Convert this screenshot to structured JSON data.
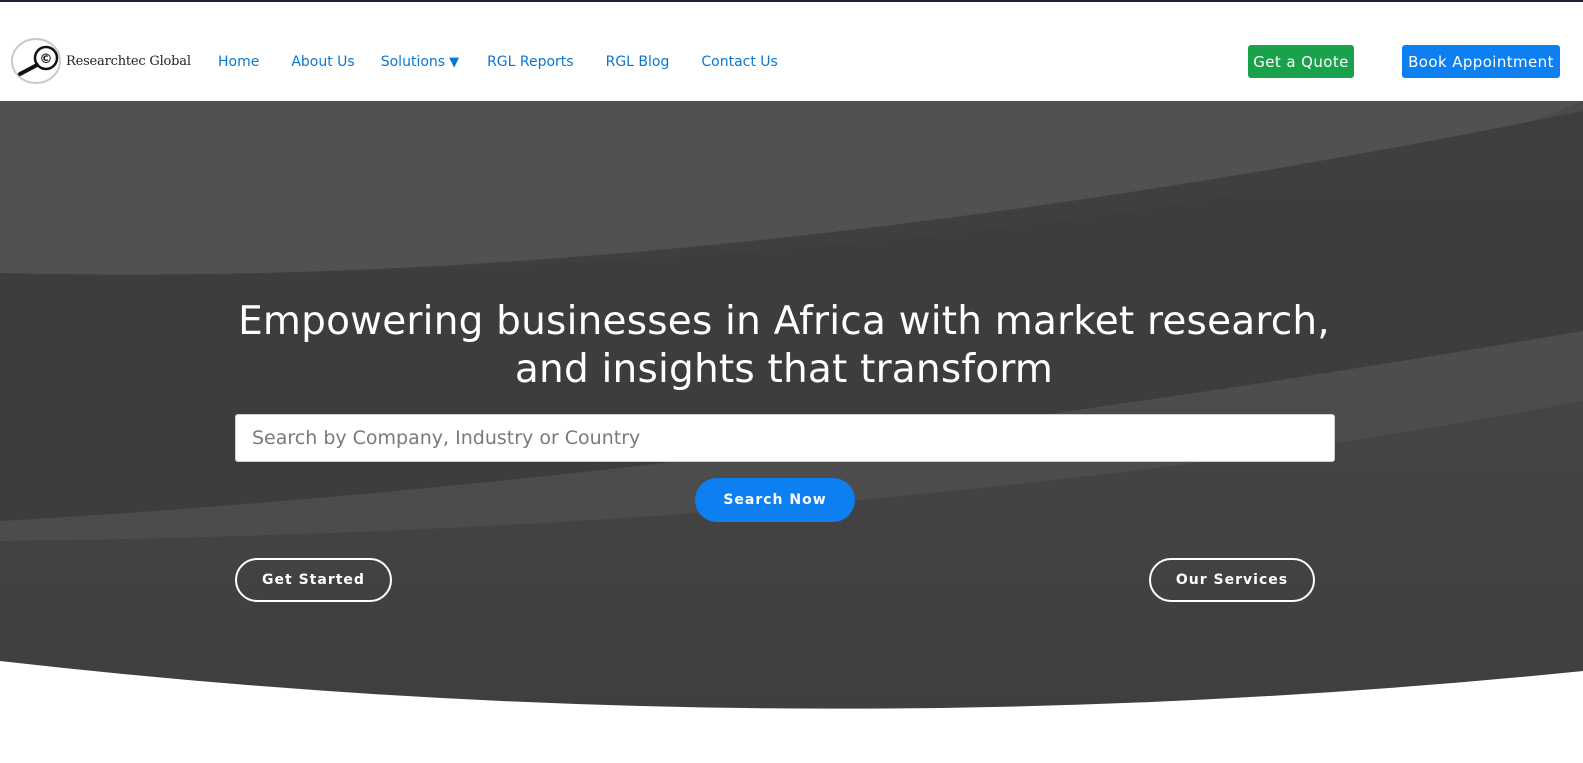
{
  "brand": {
    "name": "Researchtec Global",
    "logo_icon": "magnifier-copyright-icon"
  },
  "nav": {
    "home": "Home",
    "about": "About Us",
    "solutions": "Solutions",
    "solutions_caret": "▼",
    "reports": "RGL Reports",
    "blog": "RGL Blog",
    "contact": "Contact Us"
  },
  "actions": {
    "quote": "Get a Quote",
    "book": "Book Appointment"
  },
  "hero": {
    "headline_line1": "Empowering businesses in Africa with market research,",
    "headline_line2": "and insights that transform",
    "search_placeholder": "Search by Company, Industry or Country",
    "search_button": "Search Now",
    "get_started": "Get Started",
    "our_services": "Our Services"
  },
  "colors": {
    "nav_link": "#0b77d0",
    "quote_green": "#1aa14b",
    "primary_blue": "#0d7ff0",
    "hero_dark": "#3d3d3d",
    "top_border": "#1b2040"
  }
}
